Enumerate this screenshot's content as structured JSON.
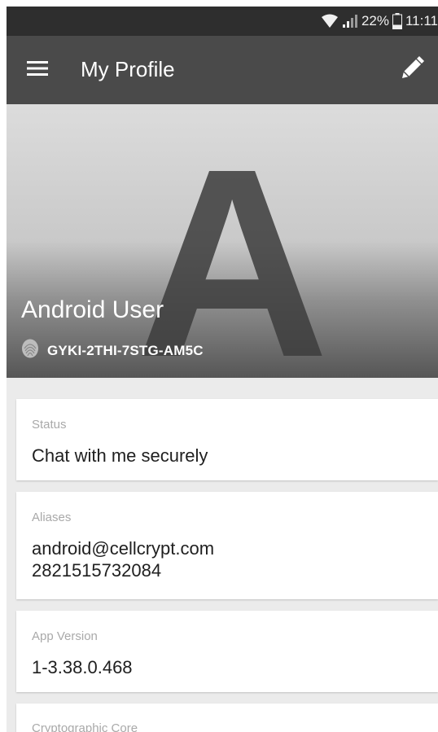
{
  "status_bar": {
    "battery": "22%",
    "time": "11:11"
  },
  "app_bar": {
    "title": "My Profile",
    "menu_icon": "hamburger-menu-icon",
    "edit_icon": "pencil-icon"
  },
  "profile": {
    "avatar_letter": "A",
    "name": "Android User",
    "fingerprint_icon": "fingerprint-icon",
    "fingerprint_id": "GYKI-2THI-7STG-AM5C"
  },
  "cards": [
    {
      "label": "Status",
      "value": "Chat with me securely"
    },
    {
      "label": "Aliases",
      "value_lines": [
        "android@cellcrypt.com",
        "2821515732084"
      ]
    },
    {
      "label": "App Version",
      "value": "1-3.38.0.468"
    },
    {
      "label": "Cryptographic Core"
    }
  ],
  "colors": {
    "app_bar": "#4a4a4a",
    "status_bar": "#2e2e2e",
    "background": "#ebebeb",
    "label": "#a9a9a9"
  }
}
